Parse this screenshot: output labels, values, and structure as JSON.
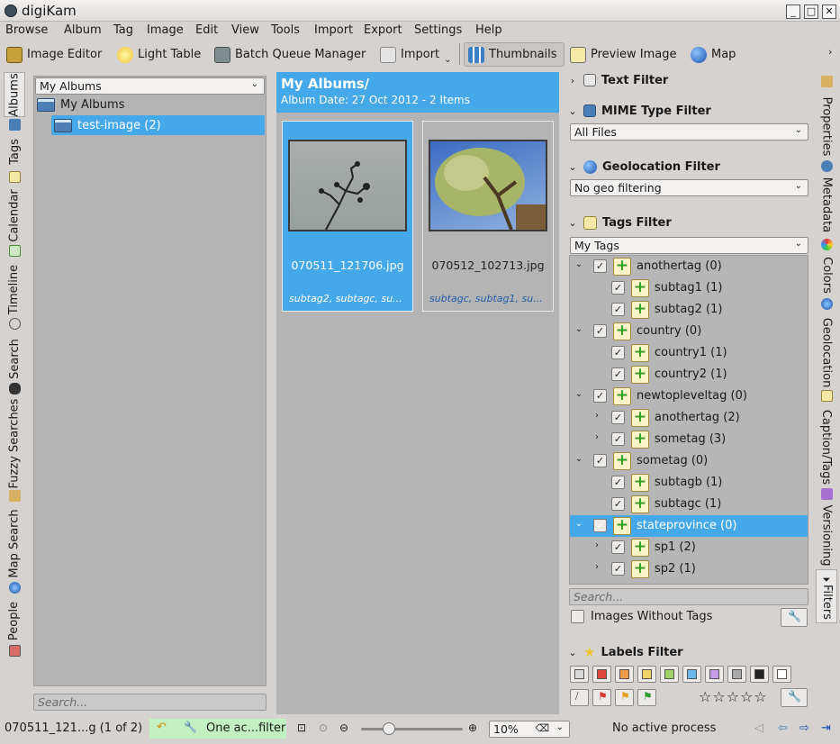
{
  "window": {
    "title": "digiKam"
  },
  "menu": [
    "Browse",
    "Album",
    "Tag",
    "Image",
    "Edit",
    "View",
    "Tools",
    "Import",
    "Export",
    "Settings",
    "Help"
  ],
  "toolbar": {
    "image_editor": "Image Editor",
    "light_table": "Light Table",
    "batch_queue": "Batch Queue Manager",
    "import": "Import",
    "thumbnails": "Thumbnails",
    "preview_image": "Preview Image",
    "map": "Map"
  },
  "left_tabs": [
    "Albums",
    "Tags",
    "Calendar",
    "Timeline",
    "Search",
    "Fuzzy Searches",
    "Map Search",
    "People"
  ],
  "album_panel": {
    "combo": "My Albums",
    "root": "My Albums",
    "child": "test-image (2)",
    "search_placeholder": "Search..."
  },
  "center": {
    "title": "My Albums/",
    "subtitle": "Album Date: 27 Oct 2012 - 2 Items",
    "thumbnails": [
      {
        "filename": "070511_121706.jpg",
        "tags": "subtag2, subtagc, su..."
      },
      {
        "filename": "070512_102713.jpg",
        "tags": "subtagc, subtag1, su..."
      }
    ]
  },
  "filters": {
    "text_filter": "Text Filter",
    "mime_filter": "MIME Type Filter",
    "mime_value": "All Files",
    "geo_filter": "Geolocation Filter",
    "geo_value": "No geo filtering",
    "tags_filter": "Tags Filter",
    "tags_combo": "My Tags",
    "tags": [
      {
        "label": "anothertag (0)",
        "level": 0,
        "expander": "down"
      },
      {
        "label": "subtag1 (1)",
        "level": 1,
        "expander": ""
      },
      {
        "label": "subtag2 (1)",
        "level": 1,
        "expander": ""
      },
      {
        "label": "country (0)",
        "level": 0,
        "expander": "down"
      },
      {
        "label": "country1 (1)",
        "level": 1,
        "expander": ""
      },
      {
        "label": "country2 (1)",
        "level": 1,
        "expander": ""
      },
      {
        "label": "newtopleveltag (0)",
        "level": 0,
        "expander": "down"
      },
      {
        "label": "anothertag (2)",
        "level": 1,
        "expander": "right"
      },
      {
        "label": "sometag (3)",
        "level": 1,
        "expander": "right"
      },
      {
        "label": "sometag (0)",
        "level": 0,
        "expander": "down"
      },
      {
        "label": "subtagb (1)",
        "level": 1,
        "expander": ""
      },
      {
        "label": "subtagc (1)",
        "level": 1,
        "expander": ""
      },
      {
        "label": "stateprovince (0)",
        "level": 0,
        "expander": "down",
        "selected": true
      },
      {
        "label": "sp1 (2)",
        "level": 1,
        "expander": "right"
      },
      {
        "label": "sp2 (1)",
        "level": 1,
        "expander": "right"
      }
    ],
    "tags_search_placeholder": "Search...",
    "images_without_tags": "Images Without Tags",
    "labels_filter": "Labels Filter",
    "color_labels": [
      "#d9d9d9",
      "#e0473b",
      "#ef9a4a",
      "#f2d466",
      "#9fd16b",
      "#6bb6e8",
      "#c79ae6",
      "#a9a9a9",
      "#222222",
      "#ffffff"
    ],
    "stars": "☆☆☆☆☆"
  },
  "right_tabs": [
    "Properties",
    "Metadata",
    "Colors",
    "Geolocation",
    "Caption/Tags",
    "Versioning",
    "Filters"
  ],
  "status": {
    "item": "070511_121...g (1 of 2)",
    "filter": "One ac...filter",
    "zoom": "10%",
    "process": "No active process"
  }
}
